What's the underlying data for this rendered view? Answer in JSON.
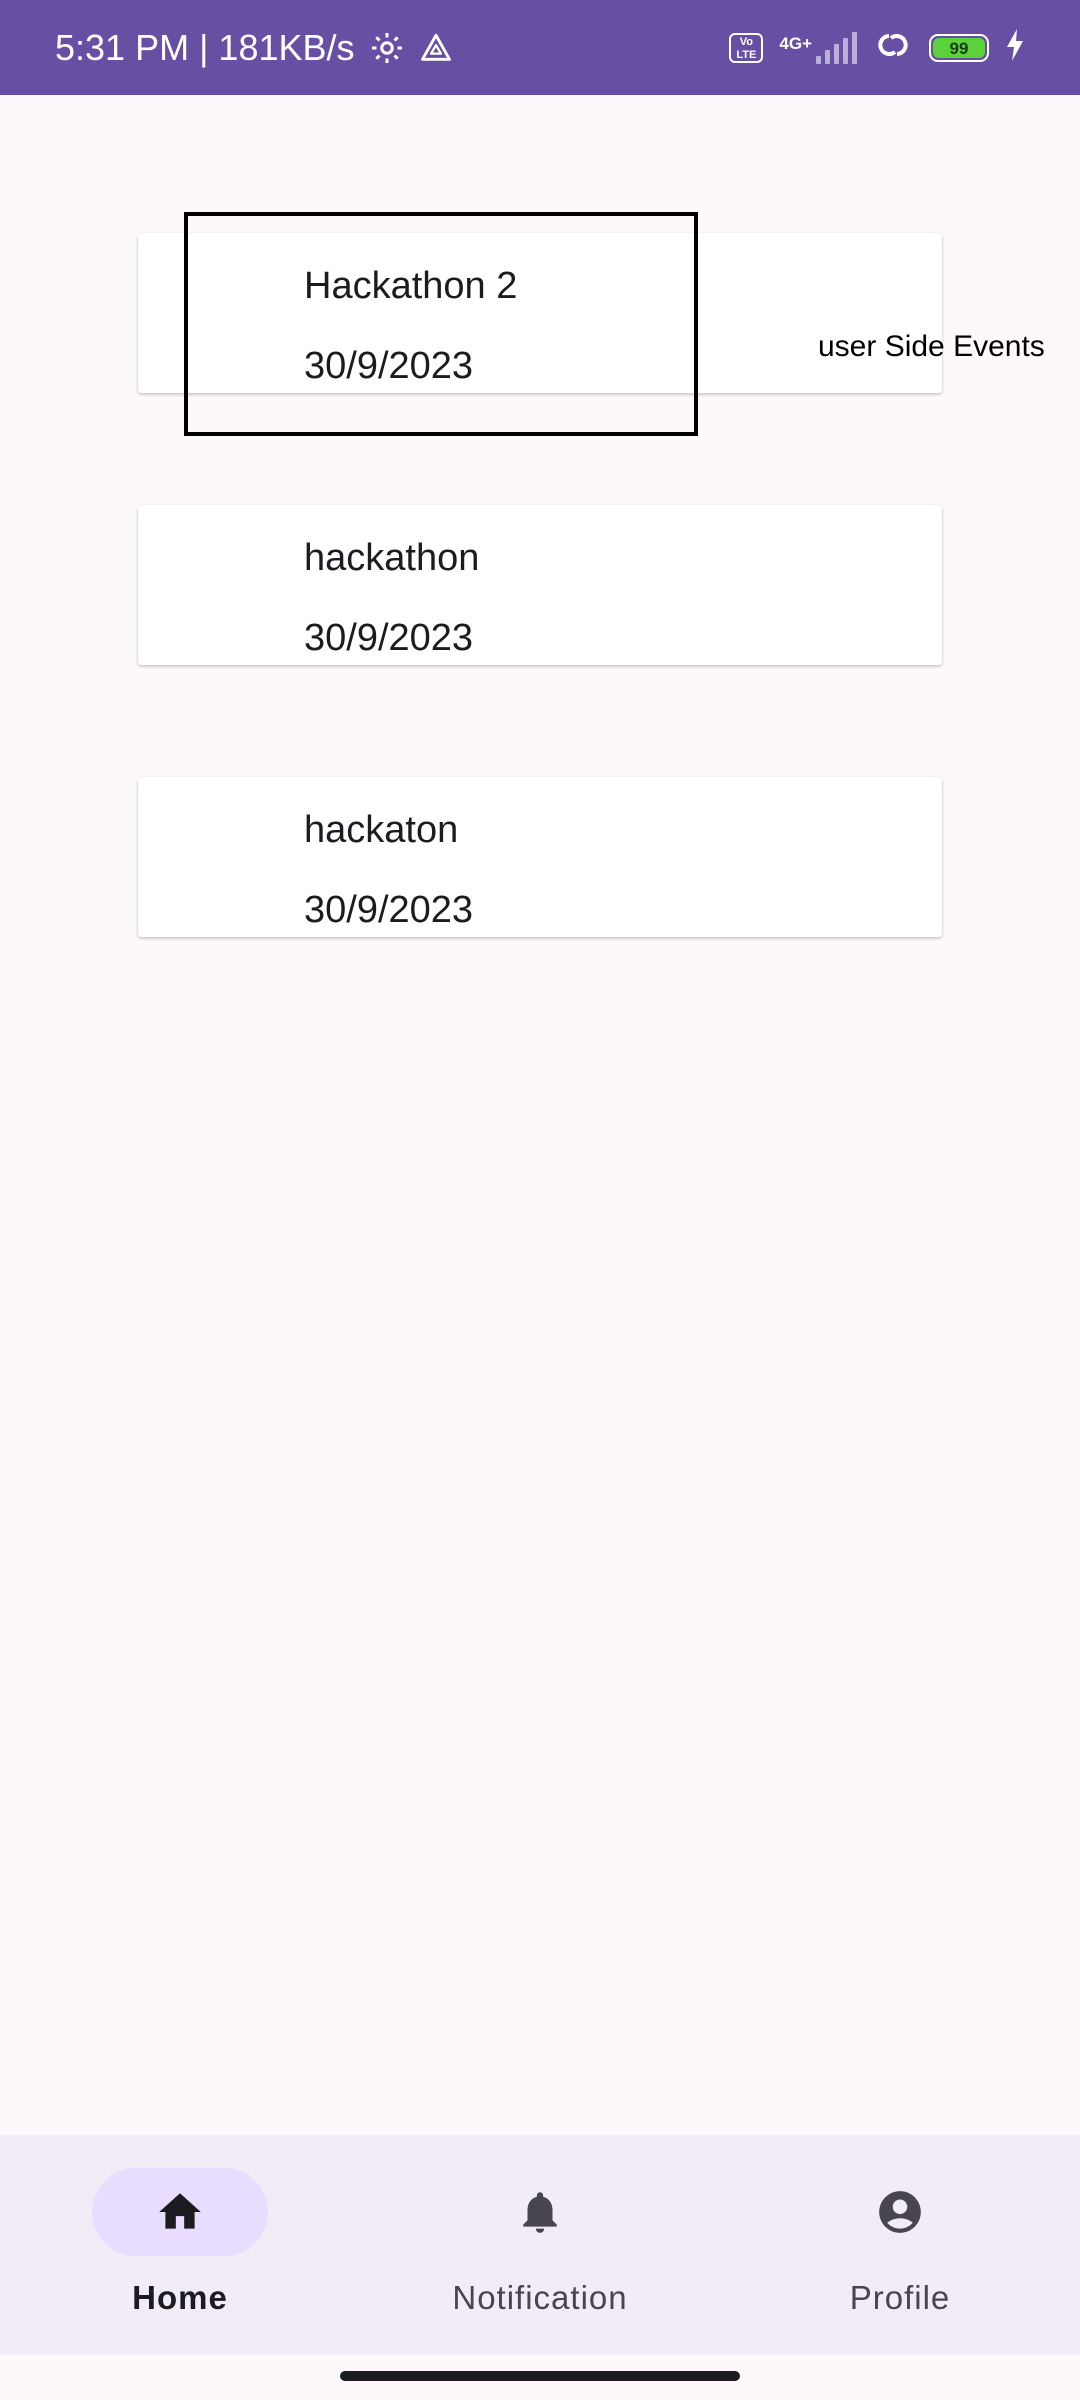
{
  "status_bar": {
    "time_and_speed": "5:31 PM | 181KB/s",
    "network_badge": "Vo LTE",
    "network_type": "4G+",
    "battery_level": "99",
    "colors": {
      "background": "#6750a4",
      "battery": "#5cd23a"
    },
    "icons": [
      "settings-gear-icon",
      "drive-triangle-icon",
      "signal-icon",
      "link-loop-icon",
      "battery-icon",
      "charging-bolt-icon"
    ]
  },
  "events": [
    {
      "title": "Hackathon 2",
      "date": "30/9/2023"
    },
    {
      "title": "hackathon",
      "date": "30/9/2023"
    },
    {
      "title": "hackaton",
      "date": "30/9/2023"
    }
  ],
  "annotation": {
    "label": "user Side Events"
  },
  "bottom_nav": {
    "items": [
      {
        "label": "Home",
        "icon": "home-icon",
        "active": true
      },
      {
        "label": "Notification",
        "icon": "bell-icon",
        "active": false
      },
      {
        "label": "Profile",
        "icon": "account-circle-icon",
        "active": false
      }
    ],
    "colors": {
      "background": "#f2ecf6",
      "active_indicator": "#e9ddff"
    }
  }
}
